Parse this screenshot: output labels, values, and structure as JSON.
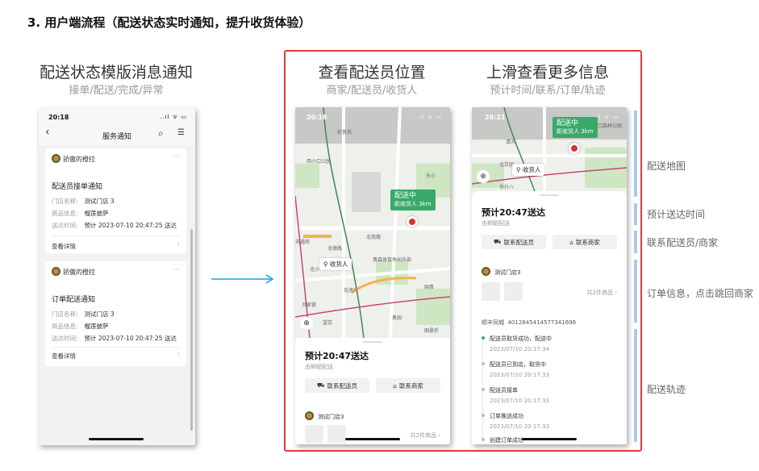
{
  "section_title": "3. 用户端流程（配送状态实时通知，提升收货体验）",
  "columns": [
    {
      "title": "配送状态模版消息通知",
      "subtitle": "接单/配送/完成/异常"
    },
    {
      "title": "查看配送员位置",
      "subtitle": "商家/配送员/收货人"
    },
    {
      "title": "上滑查看更多信息",
      "subtitle": "预计时间/联系/订单/轨迹"
    }
  ],
  "colors": {
    "frame": "#e23b35",
    "arrow": "#1e9be0",
    "green_tag": "#3aa86a",
    "side_bar": "#a9cbe8"
  },
  "phone1": {
    "time": "20:18",
    "status_icons": "..ıl ᯤ ▭",
    "back_icon": "‹",
    "header_title": "服务通知",
    "search_icon": "⌕",
    "menu_icon": "☰",
    "cards": [
      {
        "account": "骄傲的橙拉",
        "more": "···",
        "title": "配送员接单通知",
        "rows": [
          {
            "label": "门店名称:",
            "value": "测试门店 3"
          },
          {
            "label": "商品信息:",
            "value": "榴莲披萨"
          },
          {
            "label": "送达时间:",
            "value": "预计 2023-07-10 20:47:25 送达"
          }
        ],
        "detail": "查看详情",
        "chevron": "›"
      },
      {
        "account": "骄傲的橙拉",
        "more": "···",
        "title": "订单配送通知",
        "rows": [
          {
            "label": "门店名称:",
            "value": "测试门店 3"
          },
          {
            "label": "商品信息:",
            "value": "榴莲披萨"
          },
          {
            "label": "送达时间:",
            "value": "预计 2023-07-10 20:47:25 送达"
          }
        ],
        "detail": "查看详情",
        "chevron": "›"
      }
    ]
  },
  "arrow_glyph": "→",
  "phone2": {
    "time": "20:18",
    "status_icons": "..ıl ᯤ ▭",
    "tag_title": "配送中",
    "tag_sub": "距收货人 3km",
    "receiver": "收货人",
    "pois": [
      "彩鲁苑",
      "西小口公园",
      "东小",
      "北苑路",
      "龙德路",
      "天通苑",
      "奥森体育休闲乐部",
      "北小",
      "花虎沟",
      "贝家营",
      "望京",
      "奥园",
      "国惠",
      "图悬折"
    ],
    "eta": "预计20:47送达",
    "rider_name": "由柳聪配送",
    "btn_rider": "联系配送员",
    "btn_shop": "联系商家",
    "store": "测试门店3",
    "item_count": "共2件商品 ›"
  },
  "phone3": {
    "time": "20:21",
    "status_icons": "..ıl ᯤ ▭",
    "tag_title": "配送中",
    "tag_sub": "距收货人 3km",
    "receiver": "收货人",
    "pois": [
      "清河",
      "北京园",
      "东升八",
      "小口森林公园"
    ],
    "eta": "预计20:47送达",
    "rider_name": "由柳聪配送",
    "btn_rider": "联系配送员",
    "btn_shop": "联系商家",
    "store": "测试门店3",
    "item_count": "共2件商品 ›",
    "tracking_label": "顺丰同城",
    "tracking_no": "4012845414577341696",
    "timeline": [
      {
        "text": "配送员取货成功，配送中",
        "time": "2023/07/10 20:17:34",
        "active": true
      },
      {
        "text": "配送员已到店，取货中",
        "time": "2023/07/10 20:17:33",
        "active": false
      },
      {
        "text": "配送员接单",
        "time": "2023/07/10 20:17:33",
        "active": false
      },
      {
        "text": "订单推送成功",
        "time": "2023/07/10 20:17:33",
        "active": false
      },
      {
        "text": "创建订单成功",
        "time": "",
        "active": false
      }
    ]
  },
  "side_labels": [
    "配送地图",
    "预计送达时间",
    "联系配送员/商家",
    "订单信息，点击跳回商家",
    "配送轨迹"
  ]
}
